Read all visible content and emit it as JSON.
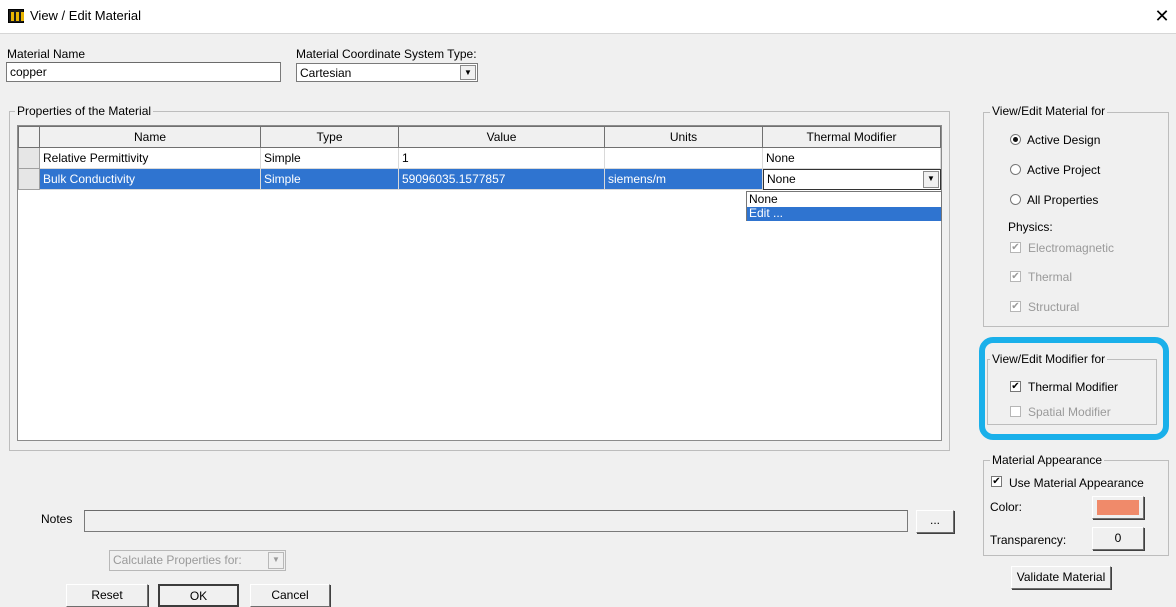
{
  "window": {
    "title": "View / Edit Material",
    "close_glyph": "✕"
  },
  "material_name": {
    "label": "Material Name",
    "value": "copper"
  },
  "coord_system": {
    "label": "Material Coordinate System Type:",
    "value": "Cartesian"
  },
  "properties": {
    "group_label": "Properties of the Material",
    "columns": [
      "Name",
      "Type",
      "Value",
      "Units",
      "Thermal Modifier"
    ],
    "rows": [
      {
        "name": "Relative Permittivity",
        "type": "Simple",
        "value": "1",
        "units": "",
        "thermal_modifier": "None"
      },
      {
        "name": "Bulk Conductivity",
        "type": "Simple",
        "value": "59096035.1577857",
        "units": "siemens/m",
        "thermal_modifier": "None"
      }
    ],
    "dropdown_options": [
      "None",
      "Edit ..."
    ]
  },
  "view_edit_for": {
    "label": "View/Edit Material for",
    "options": [
      "Active Design",
      "Active Project",
      "All Properties"
    ],
    "selected": "Active Design",
    "physics_label": "Physics:",
    "physics": [
      "Electromagnetic",
      "Thermal",
      "Structural"
    ]
  },
  "modifier_for": {
    "label": "View/Edit Modifier for",
    "thermal": "Thermal Modifier",
    "spatial": "Spatial Modifier"
  },
  "appearance": {
    "label": "Material Appearance",
    "use_label": "Use Material Appearance",
    "color_label": "Color:",
    "color": "#f08a6a",
    "transparency_label": "Transparency:",
    "transparency_value": "0"
  },
  "notes": {
    "label": "Notes",
    "browse": "..."
  },
  "calc_props": {
    "value": "Calculate Properties for:"
  },
  "buttons": {
    "validate": "Validate Material",
    "reset": "Reset",
    "ok": "OK",
    "cancel": "Cancel"
  },
  "colors": {
    "selection": "#2f74d0",
    "highlight": "#1ab0ea"
  }
}
